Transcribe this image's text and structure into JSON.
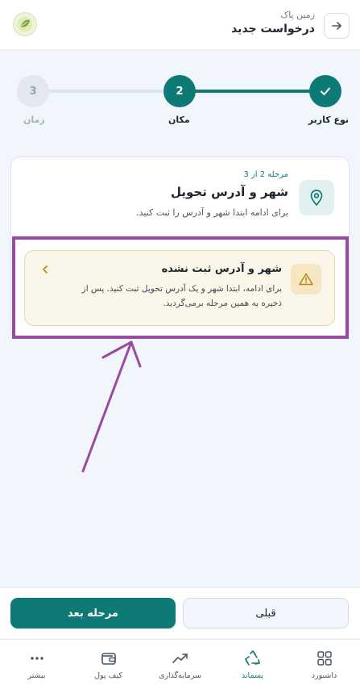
{
  "header": {
    "subtitle": "زمین پاک",
    "title": "درخواست جدید"
  },
  "stepper": {
    "steps": [
      {
        "label": "نوع کاربر",
        "number": "",
        "state": "completed"
      },
      {
        "label": "مکان",
        "number": "2",
        "state": "active"
      },
      {
        "label": "زمان",
        "number": "3",
        "state": "upcoming"
      }
    ]
  },
  "card": {
    "stage": "مرحله 2 از 3",
    "title": "شهر و آدرس تحویل",
    "subtitle": "برای ادامه ابتدا شهر و آدرس را ثبت کنید.",
    "warning": {
      "title": "شهر و آدرس ثبت نشده",
      "text": "برای ادامه، ابتدا شهر و یک آدرس تحویل ثبت کنید. پس از ذخیره به همین مرحله برمی‌گردید."
    }
  },
  "actions": {
    "prev_label": "قبلی",
    "next_label": "مرحله بعد"
  },
  "nav": {
    "items": [
      {
        "label": "داشبورد",
        "icon": "grid-icon"
      },
      {
        "label": "پسماند",
        "icon": "recycle-icon",
        "active": true
      },
      {
        "label": "سرمایه‌گذاری",
        "icon": "trend-up-icon"
      },
      {
        "label": "کیف پول",
        "icon": "wallet-icon"
      },
      {
        "label": "بیشتر",
        "icon": "more-dots-icon"
      }
    ]
  },
  "colors": {
    "primary": "#0e7a75",
    "background": "#f1f6fd",
    "warning_bg": "#fbf6ea",
    "warning_border": "#e6d8a8",
    "annotation": "#9a4aa2"
  }
}
